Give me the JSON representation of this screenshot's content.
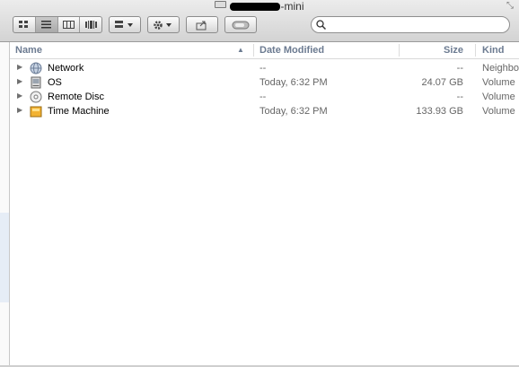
{
  "window": {
    "title_visible": "mini"
  },
  "toolbar": {
    "view_modes": [
      "icon",
      "list",
      "column",
      "coverflow"
    ],
    "active_view": "list",
    "search": {
      "value": "",
      "placeholder": ""
    }
  },
  "columns": {
    "name": "Name",
    "date_modified": "Date Modified",
    "size": "Size",
    "kind": "Kind",
    "sorted_by": "Name",
    "sort_direction": "ascending"
  },
  "items": [
    {
      "name": "Network",
      "date": "--",
      "size": "--",
      "kind": "Neighbo",
      "icon": "network-globe-icon"
    },
    {
      "name": "OS",
      "date": "Today, 6:32 PM",
      "size": "24.07 GB",
      "kind": "Volume",
      "icon": "hard-drive-icon"
    },
    {
      "name": "Remote Disc",
      "date": "--",
      "size": "--",
      "kind": "Volume",
      "icon": "optical-disc-icon"
    },
    {
      "name": "Time Machine",
      "date": "Today, 6:32 PM",
      "size": "133.93 GB",
      "kind": "Volume",
      "icon": "time-machine-drive-icon"
    }
  ],
  "colors": {
    "header_text": "#6c7b91",
    "secondary_text": "#666666"
  }
}
